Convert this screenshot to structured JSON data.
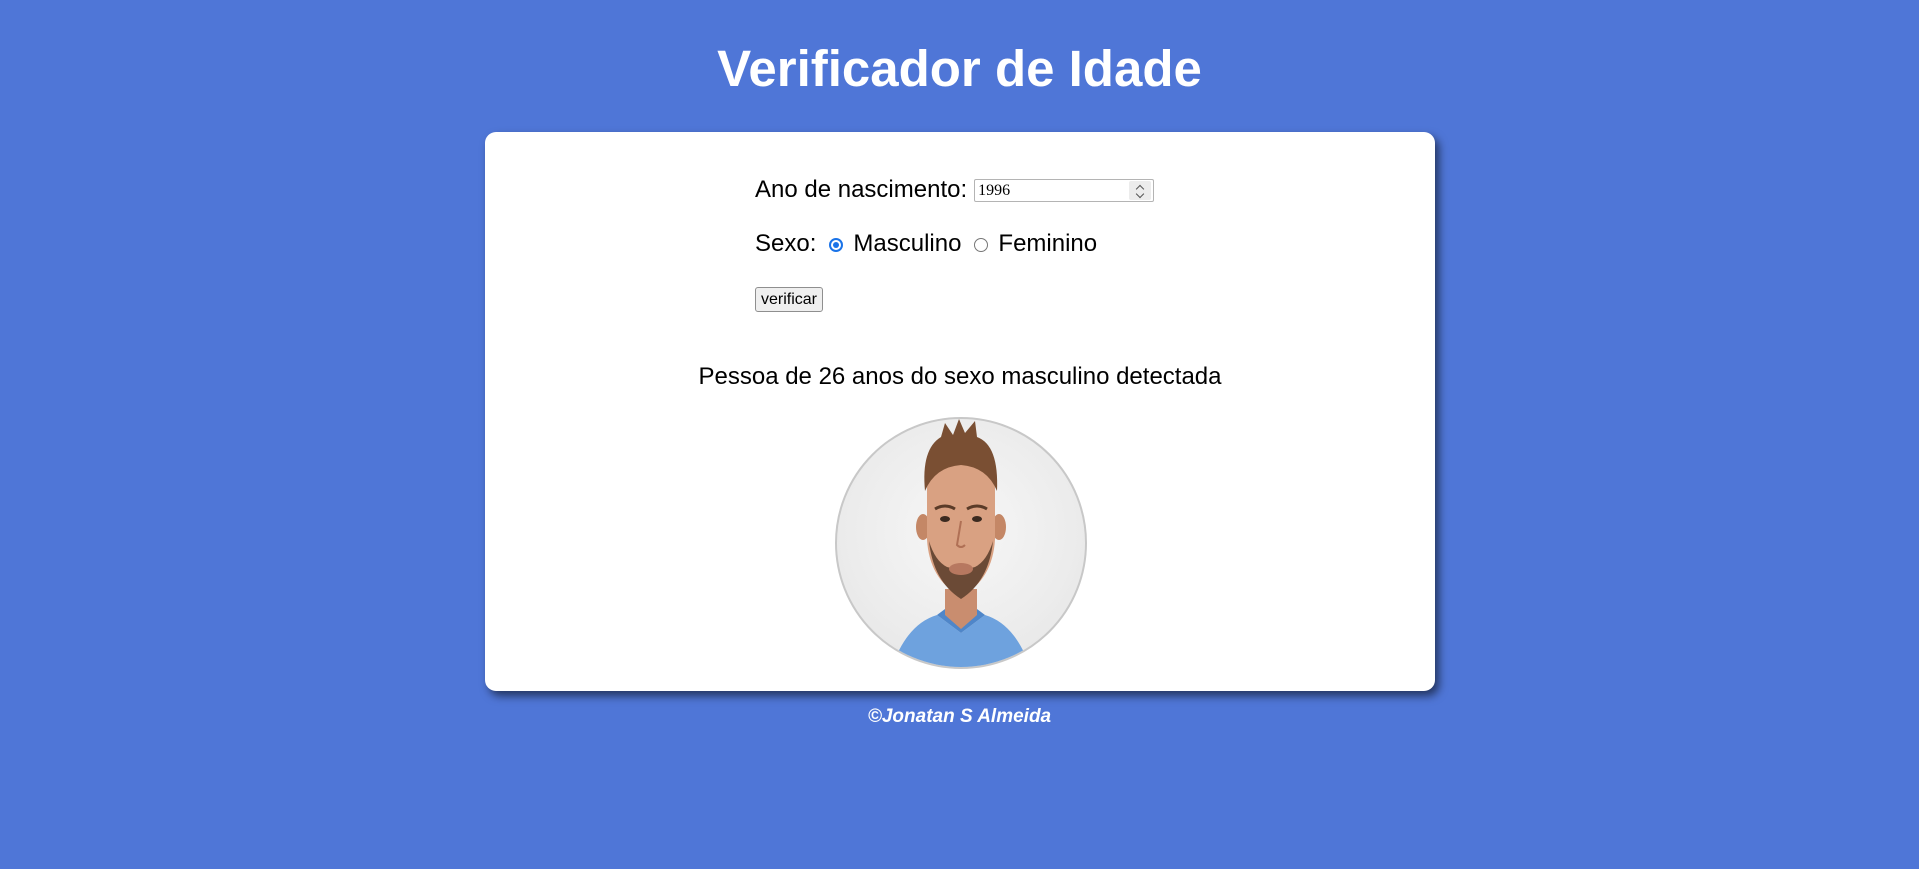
{
  "header": {
    "title": "Verificador de Idade"
  },
  "form": {
    "year_label": "Ano de nascimento:",
    "year_value": "1996",
    "sex_label": "Sexo:",
    "sex_options": [
      {
        "label": "Masculino",
        "checked": true
      },
      {
        "label": "Feminino",
        "checked": false
      }
    ],
    "verify_label": "verificar"
  },
  "result": {
    "text": "Pessoa de 26 anos do sexo masculino detectada",
    "image_subject": "man-portrait"
  },
  "footer": {
    "text": "©Jonatan S Almeida"
  },
  "colors": {
    "background": "#4f76d7",
    "card": "#ffffff",
    "radio_accent": "#1a73e8"
  }
}
